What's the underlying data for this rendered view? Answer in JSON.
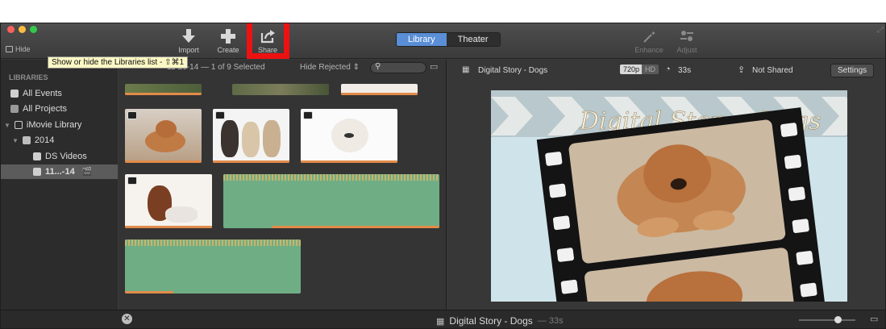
{
  "window": {
    "traffic_colors": [
      "#fc605c",
      "#fdbc40",
      "#34c84a"
    ],
    "hide_label": "Hide"
  },
  "toolbar": {
    "import_label": "Import",
    "create_label": "Create",
    "share_label": "Share",
    "enhance_label": "Enhance",
    "adjust_label": "Adjust",
    "view_tabs": [
      {
        "label": "Library",
        "active": true
      },
      {
        "label": "Theater",
        "active": false
      }
    ],
    "highlight_color": "#ee1111"
  },
  "tooltip": {
    "text": "Show or hide the Libraries list - ⇧⌘1"
  },
  "sidebar": {
    "header": "LIBRARIES",
    "items": [
      {
        "label": "All Events",
        "icon": "star-event-icon"
      },
      {
        "label": "All Projects",
        "icon": "projects-icon"
      },
      {
        "label": "iMovie Library",
        "icon": "library-grid-icon"
      },
      {
        "label": "2014",
        "icon": "calendar-icon"
      },
      {
        "label": "DS Videos",
        "icon": "star-event-icon"
      },
      {
        "label": "11...-14",
        "icon": "star-event-icon",
        "selected": true
      }
    ]
  },
  "browser": {
    "event_info": "11-20-14 — 1 of 9 Selected",
    "filter_label": "Hide Rejected",
    "search_placeholder": ""
  },
  "viewer": {
    "project_name": "Digital Story - Dogs",
    "res_720": "720p",
    "res_hd": "HD",
    "duration": "33s",
    "share_status": "Not Shared",
    "settings_label": "Settings",
    "title_overlay": "Digital Story - Dogs"
  },
  "bottom": {
    "project_name": "Digital Story - Dogs",
    "duration": "— 33s"
  }
}
